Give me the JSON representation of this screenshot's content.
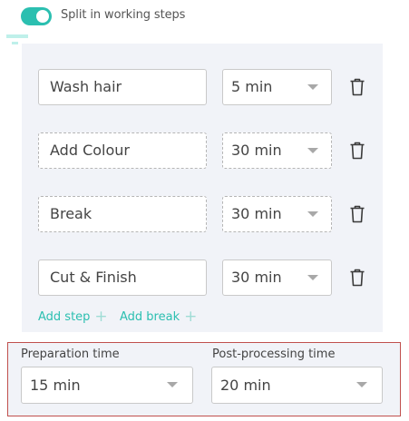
{
  "toggle": {
    "label": "Split in working steps",
    "on": true
  },
  "steps": [
    {
      "name": "Wash hair",
      "duration": "5 min",
      "style": "solid"
    },
    {
      "name": "Add Colour",
      "duration": "30 min",
      "style": "dashed"
    },
    {
      "name": "Break",
      "duration": "30 min",
      "style": "dashed"
    },
    {
      "name": "Cut & Finish",
      "duration": "30 min",
      "style": "solid"
    }
  ],
  "actions": {
    "add_step": "Add step",
    "add_break": "Add break"
  },
  "timing": {
    "preparation_label": "Preparation time",
    "preparation_value": "15 min",
    "post_label": "Post-processing time",
    "post_value": "20 min"
  },
  "colors": {
    "accent": "#2bbfb0",
    "panel": "#f1f3f8",
    "highlight_border": "#c0504d"
  },
  "icons": {
    "delete": "trash-icon",
    "expand": "chevron-down-icon",
    "add": "plus-icon"
  }
}
